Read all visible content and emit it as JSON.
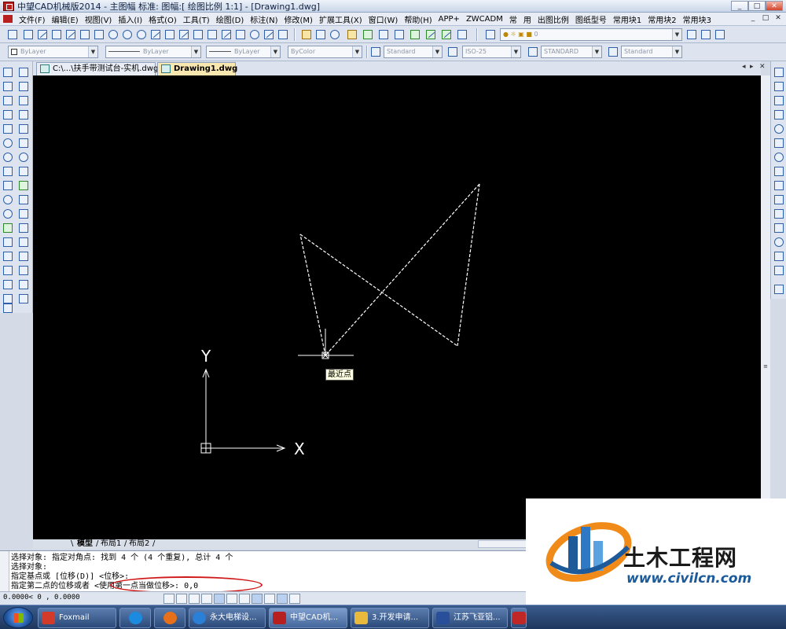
{
  "window": {
    "title": "中望CAD机械版2014 - 主图幅  标准: 图幅:[ 绘图比例 1:1] - [Drawing1.dwg]",
    "controls": [
      "_",
      "□",
      "✕"
    ]
  },
  "menubar": {
    "items": [
      "文件(F)",
      "编辑(E)",
      "视图(V)",
      "插入(I)",
      "格式(O)",
      "工具(T)",
      "绘图(D)",
      "标注(N)",
      "修改(M)",
      "扩展工具(X)",
      "窗口(W)",
      "帮助(H)",
      "APP+",
      "ZWCADM",
      "常",
      "用",
      "出图比例",
      "图纸型号",
      "常用块1",
      "常用块2",
      "常用块3"
    ]
  },
  "properties_toolbar": {
    "color": "ByLayer",
    "linetype": "ByLayer",
    "lineweight": "ByLayer",
    "plotstyle": "ByColor",
    "text_style": "Standard",
    "dim_style": "ISO-25",
    "table_style": "STANDARD",
    "multileader_style": "Standard",
    "layer": "0"
  },
  "document_tabs": [
    {
      "label": "C:\\...\\扶手带测试台-实机.dwg",
      "active": false
    },
    {
      "label": "Drawing1.dwg",
      "active": true
    }
  ],
  "canvas": {
    "ucs_x_label": "X",
    "ucs_y_label": "Y",
    "snap_tooltip": "最近点",
    "background_color": "#000000",
    "line_color": "#ffffff"
  },
  "layout_tabs": [
    "模型",
    "布局1",
    "布局2"
  ],
  "command_window": {
    "lines": [
      "选择对象: 指定对角点: 找到 4 个 (4 个重复), 总计 4 个",
      "选择对象:",
      "指定基点或 [位移(D)] <位移>:",
      "指定第二点的位移或者 <使用第一点当做位移>: 0,0"
    ]
  },
  "statusbar": {
    "coords": "0.0000<   0     , 0.0000"
  },
  "taskbar": {
    "items": [
      {
        "label": "Foxmail",
        "color": "#d23a2a"
      },
      {
        "label": "",
        "color": "#1b8be0"
      },
      {
        "label": "",
        "color": "#e8701a"
      },
      {
        "label": "永大电梯设...",
        "color": "#2a7fd6"
      },
      {
        "label": "中望CAD机...",
        "color": "#b82020"
      },
      {
        "label": "3.开发申请...",
        "color": "#e8b93a"
      },
      {
        "label": "江苏飞亚铝...",
        "color": "#2a4f9a"
      },
      {
        "label": "",
        "color": "#c02828"
      }
    ]
  },
  "watermark": {
    "brand": "土木工程网",
    "url": "www.civilcn.com"
  }
}
